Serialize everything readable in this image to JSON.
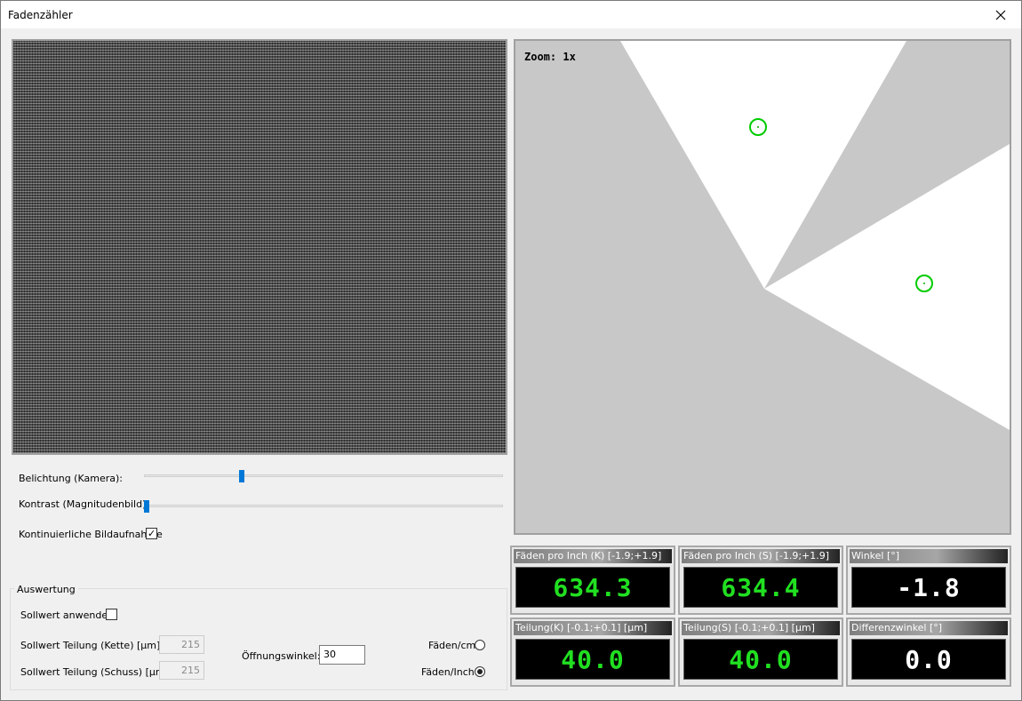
{
  "window": {
    "title": "Fadenzähler"
  },
  "camera_view": {},
  "magnitude_view": {
    "zoom_label": "Zoom: 1x"
  },
  "controls": {
    "exposure_label": "Belichtung (Kamera):",
    "exposure_level": 0.27,
    "contrast_label": "Kontrast (Magnitudenbild):",
    "contrast_level": 0.0,
    "continuous_label": "Kontinuierliche Bildaufnahme",
    "continuous_checked": true
  },
  "evaluation": {
    "group_label": "Auswertung",
    "apply_label": "Sollwert anwenden",
    "apply_checked": false,
    "warp_label": "Sollwert Teilung (Kette) [µm]:",
    "warp_value": "215",
    "weft_label": "Sollwert Teilung (Schuss) [µm]:",
    "weft_value": "215",
    "angle_label": "Öffnungswinkel:",
    "angle_value": "30",
    "unit_cm_label": "Fäden/cm",
    "unit_inch_label": "Fäden/Inch",
    "selected_unit": "inch"
  },
  "panels": {
    "p1": {
      "header": "Fäden pro Inch (K)  [-1.9;+1.9]",
      "value": "634.3",
      "color": "#21e021"
    },
    "p2": {
      "header": "Fäden pro Inch (S)  [-1.9;+1.9]",
      "value": "634.4",
      "color": "#21e021"
    },
    "p3": {
      "header": "Winkel [°]",
      "value": "-1.8",
      "color": "#ffffff"
    },
    "p4": {
      "header": "Teilung(K)  [-0.1;+0.1] [µm]",
      "value": "40.0",
      "color": "#21e021"
    },
    "p5": {
      "header": "Teilung(S)  [-0.1;+0.1] [µm]",
      "value": "40.0",
      "color": "#21e021"
    },
    "p6": {
      "header": "Differenzwinkel [°]",
      "value": "0.0",
      "color": "#ffffff"
    }
  },
  "colors": {
    "accent": "#0078d7",
    "marker": "#00cc00",
    "display_green": "#21e021"
  },
  "icons": {
    "close": "close-icon",
    "check": "checkmark-icon"
  }
}
